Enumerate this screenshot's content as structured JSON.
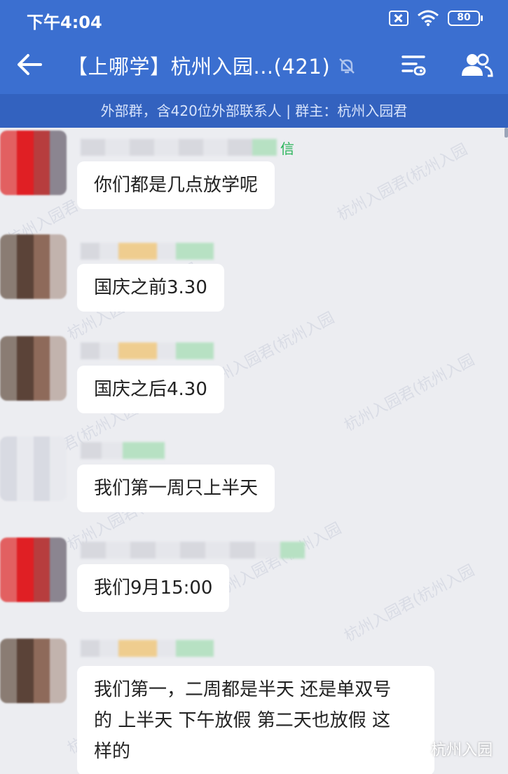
{
  "status_bar": {
    "time": "下午4:04",
    "battery": "80"
  },
  "header": {
    "title": "【上哪学】杭州入园...(421)"
  },
  "info_bar": {
    "text": "外部群，含420位外部联系人 | 群主：杭州入园君"
  },
  "watermark": "杭州入园君(杭州入园",
  "messages": [
    {
      "name_suffix": "信",
      "lines": [
        "你们都是几点放学呢"
      ]
    },
    {
      "name_suffix": "",
      "lines": [
        "国庆之前3.30"
      ]
    },
    {
      "name_suffix": "",
      "lines": [
        "国庆之后4.30"
      ]
    },
    {
      "name_suffix": "",
      "lines": [
        "我们第一周只上半天"
      ]
    },
    {
      "name_suffix": "",
      "lines": [
        "我们9月15:00"
      ]
    },
    {
      "name_suffix": "",
      "lines": [
        "我们第一，二周都是半天 还是单双号",
        "的 上半天 下午放假 第二天也放假 这",
        "样的"
      ]
    }
  ],
  "footer_badge": "杭州入园",
  "colors": {
    "header_blue": "#3b6fd0",
    "info_blue": "#3362bf",
    "chat_bg": "#ecedf1",
    "name_green": "#27b458"
  }
}
